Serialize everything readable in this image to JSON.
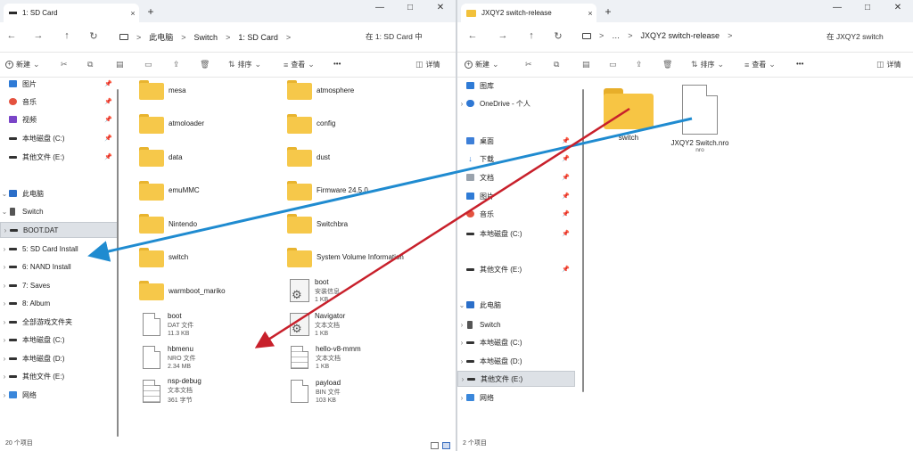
{
  "left": {
    "tab_title": "1: SD Card",
    "tab_close": "×",
    "new_tab": "+",
    "win_controls": {
      "min": "—",
      "max": "□",
      "close": "✕"
    },
    "nav_buttons": {
      "back": "←",
      "forward": "→",
      "up": "↑",
      "refresh": "↻"
    },
    "breadcrumb": [
      "此电脑",
      "Switch",
      "1: SD Card"
    ],
    "crumb_sep": ">",
    "search_placeholder": "在 1: SD Card 中",
    "toolbar": {
      "new": "新建",
      "sort": "排序",
      "view": "查看",
      "more": "•••",
      "details": "详情"
    },
    "nav_items": [
      {
        "label": "图片",
        "icon": "img",
        "pin": true
      },
      {
        "label": "音乐",
        "icon": "music",
        "pin": true
      },
      {
        "label": "视频",
        "icon": "video",
        "pin": true
      },
      {
        "label": "本地磁盘 (C:)",
        "icon": "drive",
        "pin": true
      },
      {
        "label": "其他文件 (E:)",
        "icon": "drive",
        "pin": true
      },
      {
        "label": "此电脑",
        "icon": "pc",
        "chev": "v"
      },
      {
        "label": "Switch",
        "icon": "phone",
        "chev": "v"
      },
      {
        "label": "BOOT.DAT",
        "icon": "drive",
        "chev": ">",
        "selected": true
      },
      {
        "label": "5: SD Card Install",
        "icon": "drive",
        "chev": ">"
      },
      {
        "label": "6: NAND Install",
        "icon": "drive",
        "chev": ">"
      },
      {
        "label": "7: Saves",
        "icon": "drive",
        "chev": ">"
      },
      {
        "label": "8: Album",
        "icon": "drive",
        "chev": ">"
      },
      {
        "label": "全部游戏文件夹",
        "icon": "drive",
        "chev": ">"
      },
      {
        "label": "本地磁盘 (C:)",
        "icon": "drive",
        "chev": ">"
      },
      {
        "label": "本地磁盘 (D:)",
        "icon": "drive",
        "chev": ">"
      },
      {
        "label": "其他文件 (E:)",
        "icon": "drive",
        "chev": ">"
      },
      {
        "label": "网络",
        "icon": "net",
        "chev": ">"
      }
    ],
    "files_col1": [
      {
        "name": "mesa",
        "kind": "folder"
      },
      {
        "name": "atmoloader",
        "kind": "folder"
      },
      {
        "name": "data",
        "kind": "folder"
      },
      {
        "name": "emuMMC",
        "kind": "folder"
      },
      {
        "name": "Nintendo",
        "kind": "folder"
      },
      {
        "name": "switch",
        "kind": "folder"
      },
      {
        "name": "warmboot_mariko",
        "kind": "folder"
      },
      {
        "name": "boot",
        "kind": "doc",
        "type": "DAT 文件",
        "size": "11.3 KB"
      },
      {
        "name": "hbmenu",
        "kind": "doc",
        "type": "NRO 文件",
        "size": "2.34 MB"
      },
      {
        "name": "nsp-debug",
        "kind": "lines",
        "type": "文本文档",
        "size": "361 字节"
      }
    ],
    "files_col2": [
      {
        "name": "atmosphere",
        "kind": "folder"
      },
      {
        "name": "config",
        "kind": "folder"
      },
      {
        "name": "dust",
        "kind": "folder"
      },
      {
        "name": "Firmware 24.5.0",
        "kind": "folder"
      },
      {
        "name": "Switchbra",
        "kind": "folder"
      },
      {
        "name": "System Volume Information",
        "kind": "folder"
      },
      {
        "name": "boot",
        "kind": "gear",
        "type": "安装信息",
        "size": "1 KB"
      },
      {
        "name": "Navigator",
        "kind": "gear",
        "type": "文本文档",
        "size": "1 KB"
      },
      {
        "name": "hello-v8-mmm",
        "kind": "lines",
        "type": "文本文档",
        "size": "1 KB"
      },
      {
        "name": "payload",
        "kind": "doc",
        "type": "BIN 文件",
        "size": "103 KB"
      }
    ],
    "status": "20 个项目"
  },
  "right": {
    "tab_title": "JXQY2 switch-release",
    "tab_close": "×",
    "new_tab": "+",
    "win_controls": {
      "min": "—",
      "max": "□",
      "close": "✕"
    },
    "nav_buttons": {
      "back": "←",
      "forward": "→",
      "up": "↑",
      "refresh": "↻"
    },
    "breadcrumb_more": "…",
    "breadcrumb": [
      "JXQY2 switch-release"
    ],
    "crumb_sep": ">",
    "search_placeholder": "在 JXQY2 switch",
    "toolbar": {
      "new": "新建",
      "sort": "排序",
      "view": "查看",
      "more": "•••",
      "details": "详情"
    },
    "nav_items": [
      {
        "label": "图库",
        "icon": "img"
      },
      {
        "label": "OneDrive - 个人",
        "icon": "cloud",
        "chev": ">"
      },
      {
        "label": "桌面",
        "icon": "desk",
        "pin": true
      },
      {
        "label": "下载",
        "icon": "down",
        "pin": true
      },
      {
        "label": "文档",
        "icon": "doc",
        "pin": true
      },
      {
        "label": "图片",
        "icon": "img",
        "pin": true
      },
      {
        "label": "音乐",
        "icon": "music",
        "pin": true
      },
      {
        "label": "本地磁盘 (C:)",
        "icon": "drive",
        "pin": true
      },
      {
        "label": "其他文件 (E:)",
        "icon": "drive",
        "pin": true
      },
      {
        "label": "此电脑",
        "icon": "pc",
        "chev": "v"
      },
      {
        "label": "Switch",
        "icon": "phone",
        "chev": ">"
      },
      {
        "label": "本地磁盘 (C:)",
        "icon": "drive",
        "chev": ">"
      },
      {
        "label": "本地磁盘 (D:)",
        "icon": "drive",
        "chev": ">"
      },
      {
        "label": "其他文件 (E:)",
        "icon": "drive",
        "chev": ">",
        "selected": true
      },
      {
        "label": "网络",
        "icon": "net",
        "chev": ">"
      }
    ],
    "items": [
      {
        "name": "switch",
        "kind": "folder"
      },
      {
        "name": "JXQY2 Switch.nro",
        "sub": "nro",
        "kind": "doc"
      }
    ],
    "status": "2 个项目"
  },
  "colors": {
    "arrow_blue": "#1f8bd0",
    "arrow_red": "#c8202b",
    "folder": "#f6c84a",
    "selected": "#dde1e6"
  }
}
